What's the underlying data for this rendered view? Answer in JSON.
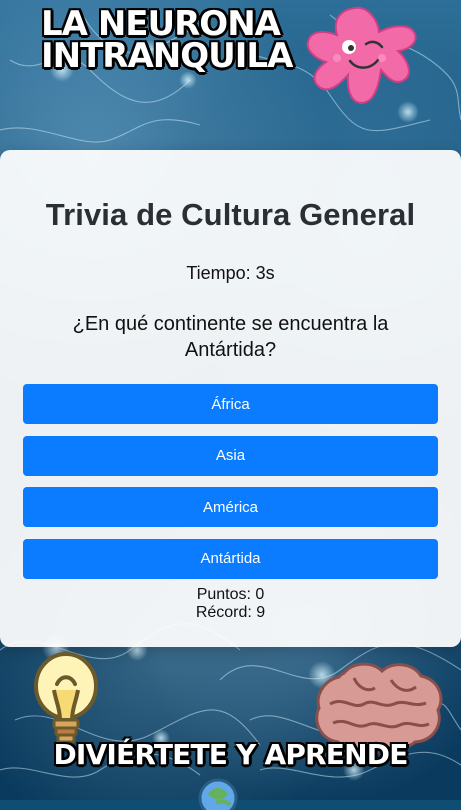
{
  "header": {
    "logo_line_1": "LA NEURONA",
    "logo_line_2": "INTRANQUILA"
  },
  "quiz": {
    "title": "Trivia de Cultura General",
    "timer": "Tiempo: 3s",
    "question": "¿En qué continente se encuentra la Antártida?",
    "answers": [
      {
        "label": "África"
      },
      {
        "label": "Asia"
      },
      {
        "label": "América"
      },
      {
        "label": "Antártida"
      }
    ],
    "score": "Puntos: 0",
    "record": "Récord: 9"
  },
  "footer": {
    "slogan": "DIVIÉRTETE Y APRENDE"
  },
  "icons": {
    "neuron": "neuron-character-icon",
    "bulb": "lightbulb-icon",
    "brain": "brain-icon",
    "globe": "globe-icon"
  },
  "colors": {
    "button_blue": "#0b7cff",
    "background_blue": "#0f4d73",
    "card_bg": "#ffffff",
    "title_text": "#2a2f34"
  }
}
